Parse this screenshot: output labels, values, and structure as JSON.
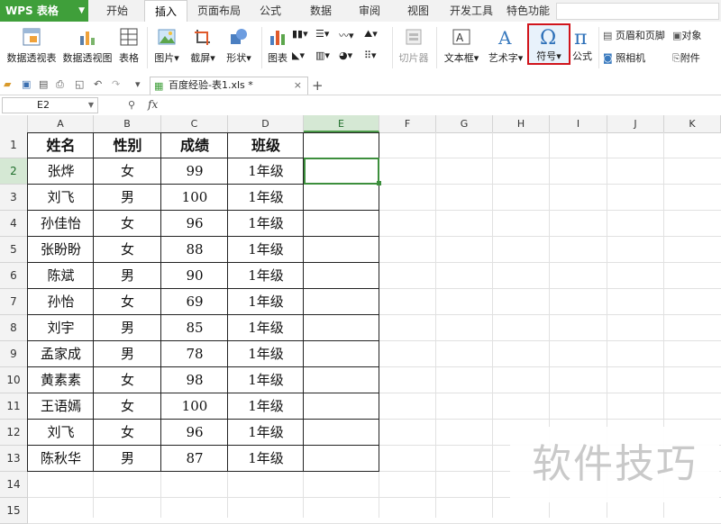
{
  "app": {
    "name": "WPS 表格"
  },
  "menu": {
    "tabs": [
      "开始",
      "插入",
      "页面布局",
      "公式",
      "数据",
      "审阅",
      "视图",
      "开发工具",
      "特色功能"
    ],
    "active": "插入"
  },
  "ribbon": {
    "pivot_table": "数据透视表",
    "pivot_chart": "数据透视图",
    "table": "表格",
    "picture": "图片",
    "screenshot": "截屏",
    "shape": "形状",
    "chart": "图表",
    "slicer": "切片器",
    "textbox": "文本框",
    "wordart": "艺术字",
    "symbol": "符号",
    "formula": "公式",
    "header_footer": "页眉和页脚",
    "camera": "照相机",
    "object": "对象",
    "attachment": "附件"
  },
  "document": {
    "tab_title": "百度经验-表1.xls *",
    "close": "×",
    "new_tab": "+"
  },
  "formula_bar": {
    "cell_ref": "E2",
    "fx": "fx",
    "value": ""
  },
  "sheet": {
    "columns": [
      "A",
      "B",
      "C",
      "D",
      "E",
      "F",
      "G",
      "H",
      "I",
      "J",
      "K"
    ],
    "rows": [
      "1",
      "2",
      "3",
      "4",
      "5",
      "6",
      "7",
      "8",
      "9",
      "10",
      "11",
      "12",
      "13",
      "14",
      "15"
    ],
    "header": [
      "姓名",
      "性别",
      "成绩",
      "班级"
    ],
    "data": [
      [
        "张烨",
        "女",
        "99",
        "1年级"
      ],
      [
        "刘飞",
        "男",
        "100",
        "1年级"
      ],
      [
        "孙佳怡",
        "女",
        "96",
        "1年级"
      ],
      [
        "张盼盼",
        "女",
        "88",
        "1年级"
      ],
      [
        "陈斌",
        "男",
        "90",
        "1年级"
      ],
      [
        "孙怡",
        "女",
        "69",
        "1年级"
      ],
      [
        "刘宇",
        "男",
        "85",
        "1年级"
      ],
      [
        "孟家成",
        "男",
        "78",
        "1年级"
      ],
      [
        "黄素素",
        "女",
        "98",
        "1年级"
      ],
      [
        "王语嫣",
        "女",
        "100",
        "1年级"
      ],
      [
        "刘飞",
        "女",
        "96",
        "1年级"
      ],
      [
        "陈秋华",
        "男",
        "87",
        "1年级"
      ]
    ],
    "selected_cell": "E2"
  },
  "watermark": "软件技巧",
  "colors": {
    "accent": "#3f9f3a",
    "highlight": "#d1141b",
    "selection": "#3d8f3d"
  }
}
